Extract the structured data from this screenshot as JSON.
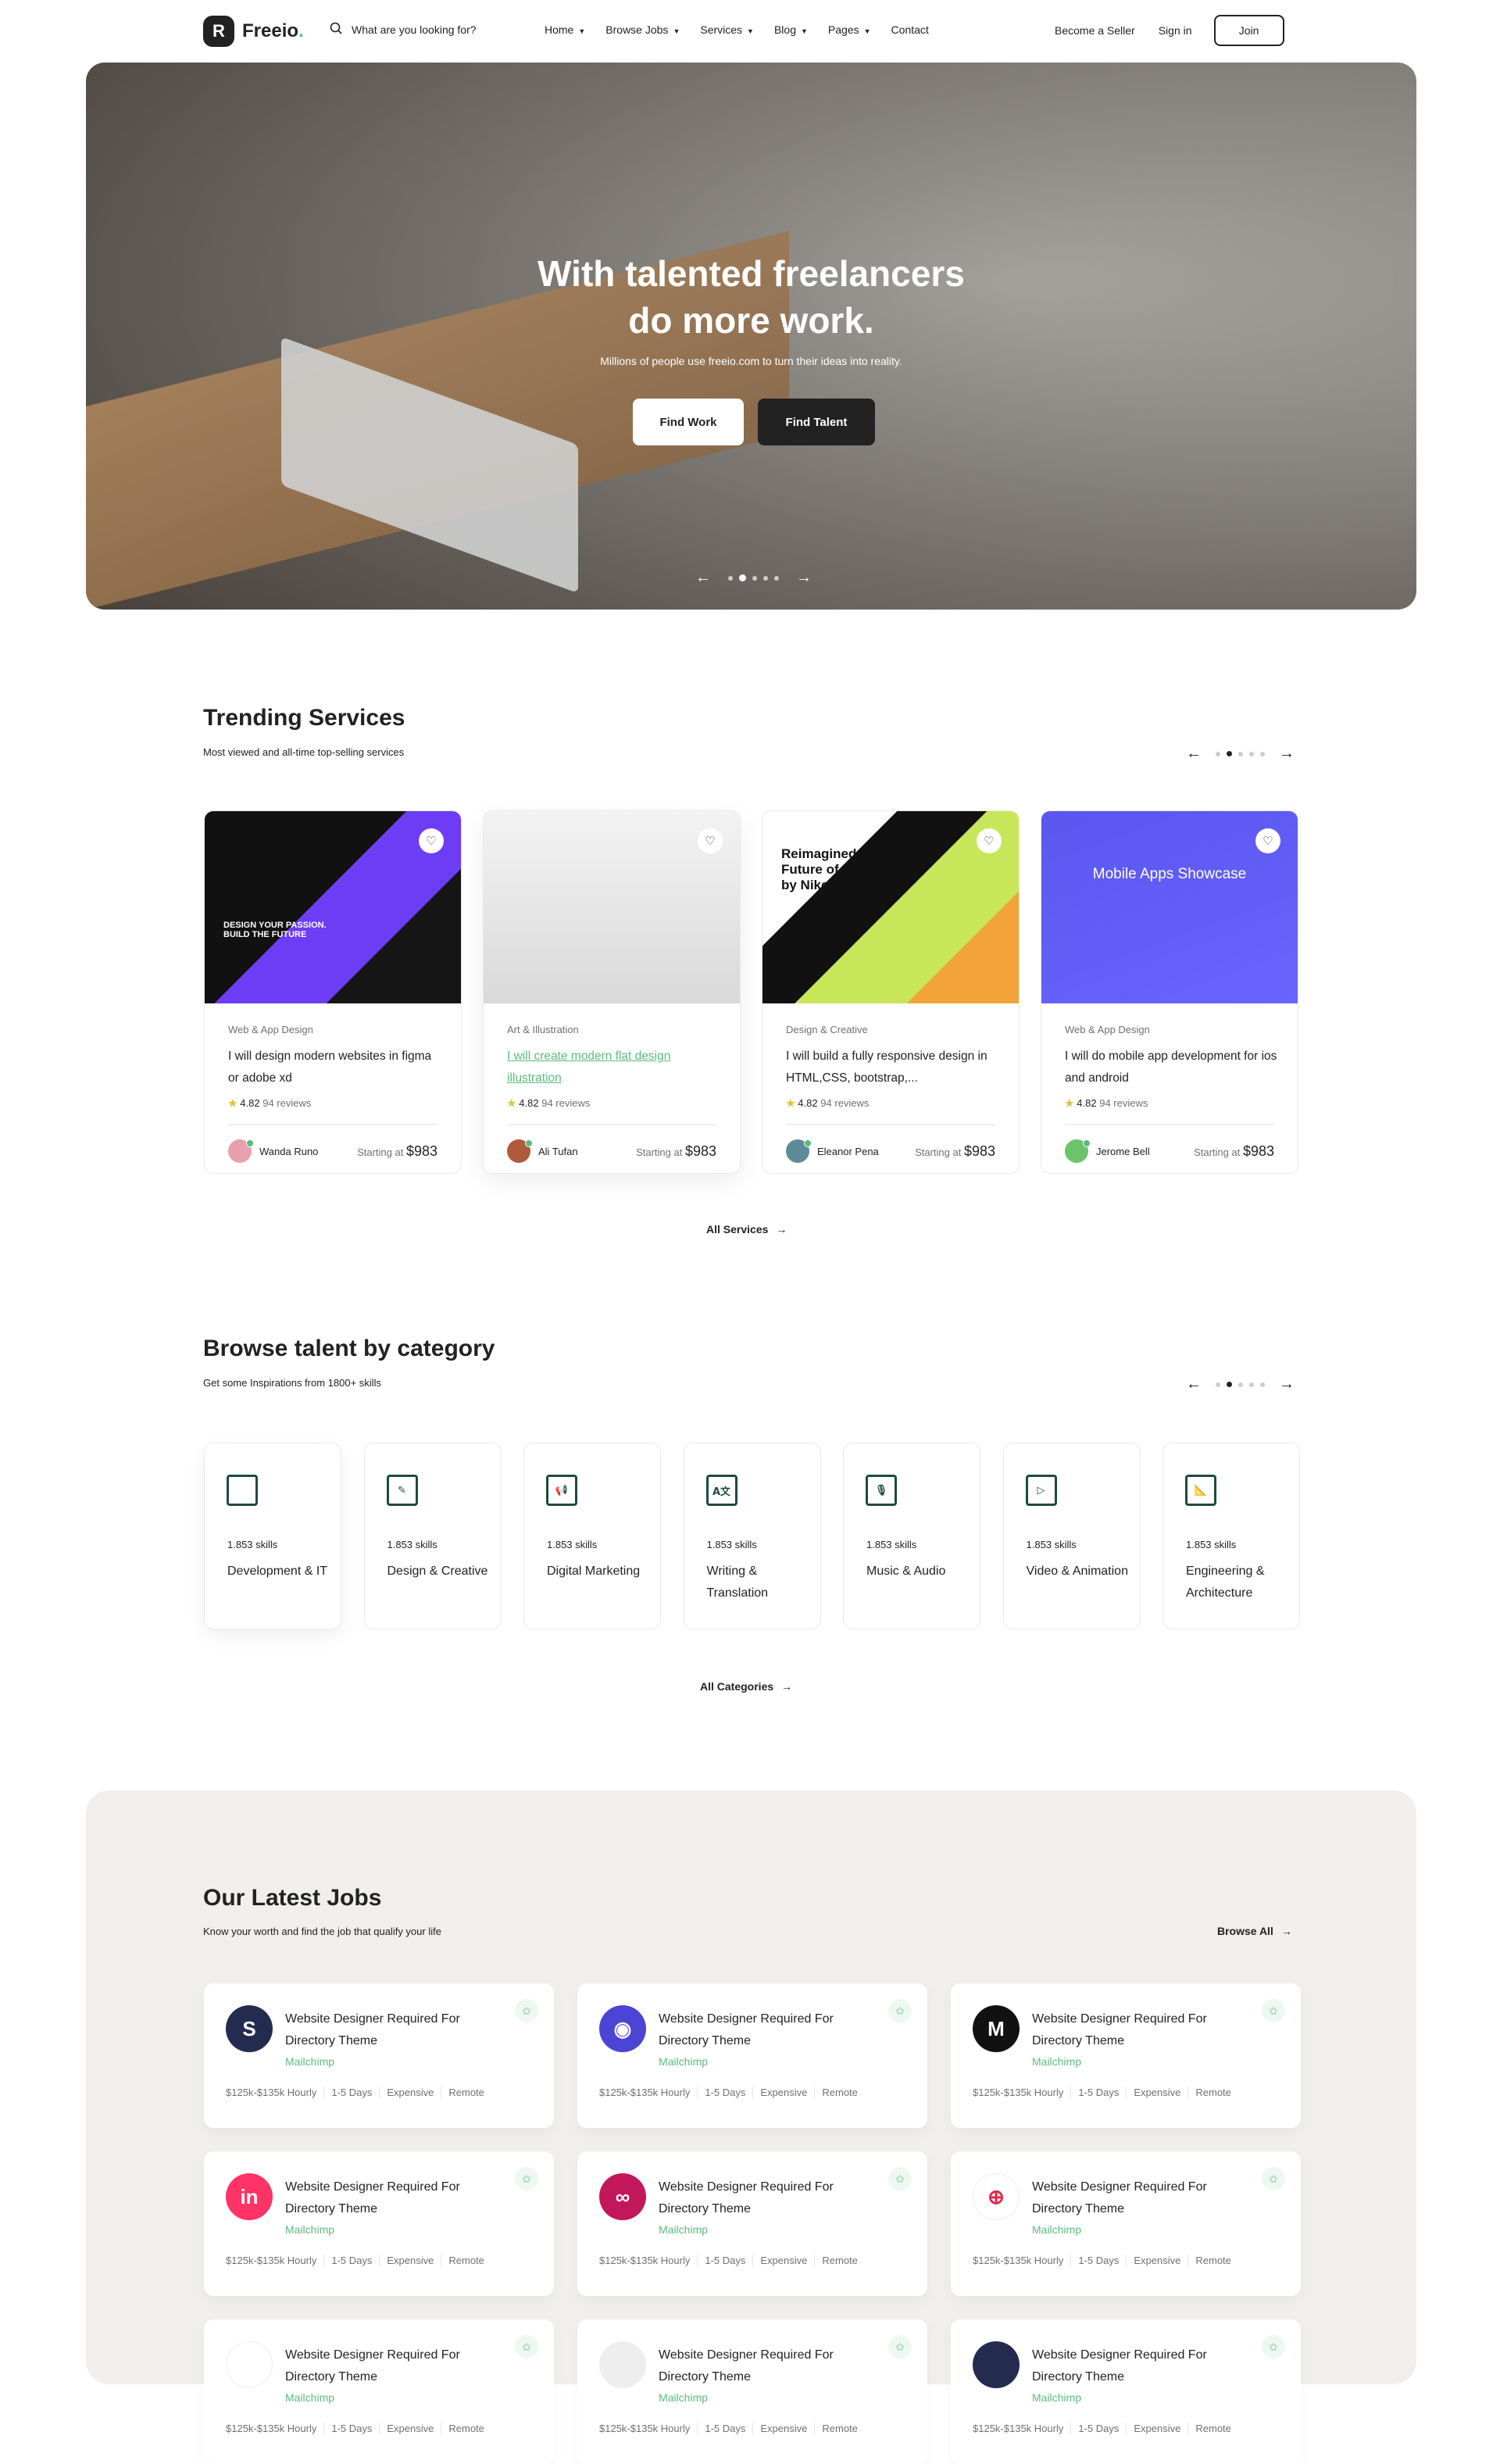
{
  "nav": {
    "logo": "Freeio",
    "logo_mark": "R",
    "search_placeholder": "What are you looking for?",
    "menu": [
      {
        "label": "Home",
        "dropdown": true
      },
      {
        "label": "Browse Jobs",
        "dropdown": true
      },
      {
        "label": "Services",
        "dropdown": true
      },
      {
        "label": "Blog",
        "dropdown": true
      },
      {
        "label": "Pages",
        "dropdown": true
      },
      {
        "label": "Contact",
        "dropdown": false
      }
    ],
    "become_seller": "Become a Seller",
    "sign_in": "Sign in",
    "join": "Join"
  },
  "hero": {
    "title_line1": "With talented freelancers",
    "title_line2": "do more work.",
    "subtitle": "Millions of people use freeio.com to turn their ideas into reality.",
    "find_work": "Find Work",
    "find_talent": "Find Talent",
    "slide_count": 5,
    "active_slide": 2
  },
  "trending": {
    "title": "Trending Services",
    "subtitle": "Most viewed and all-time top-selling services",
    "all_label": "All Services",
    "cards": [
      {
        "category": "Web & App Design",
        "title": "I will design modern websites in figma or adobe xd",
        "rating": "4.82",
        "reviews": "94 reviews",
        "seller": "Wanda Runo",
        "starting": "Starting at",
        "price": "$983",
        "img_text": "DESIGN YOUR PASSION. BUILD THE FUTURE"
      },
      {
        "category": "Art & Illustration",
        "title": "I will create modern flat design illustration",
        "rating": "4.82",
        "reviews": "94 reviews",
        "seller": "Ali Tufan",
        "starting": "Starting at",
        "price": "$983"
      },
      {
        "category": "Design & Creative",
        "title": "I will build a fully responsive design in HTML,CSS, bootstrap,...",
        "rating": "4.82",
        "reviews": "94 reviews",
        "seller": "Eleanor Pena",
        "starting": "Starting at",
        "price": "$983",
        "img_text": "Reimagined Future of Motion by Nike."
      },
      {
        "category": "Web & App Design",
        "title": "I will do mobile app development for ios and android",
        "rating": "4.82",
        "reviews": "94 reviews",
        "seller": "Jerome Bell",
        "starting": "Starting at",
        "price": "$983",
        "img_text": "Mobile Apps Showcase"
      }
    ]
  },
  "categories": {
    "title": "Browse talent by category",
    "subtitle": "Get some Inspirations from 1800+ skills",
    "all_label": "All Categories",
    "items": [
      {
        "skills": "1.853 skills",
        "name": "Development & IT"
      },
      {
        "skills": "1.853 skills",
        "name": "Design & Creative"
      },
      {
        "skills": "1.853 skills",
        "name": "Digital Marketing"
      },
      {
        "skills": "1.853 skills",
        "name": "Writing & Translation"
      },
      {
        "skills": "1.853 skills",
        "name": "Music & Audio"
      },
      {
        "skills": "1.853 skills",
        "name": "Video & Animation"
      },
      {
        "skills": "1.853 skills",
        "name": "Engineering & Architecture"
      }
    ]
  },
  "jobs": {
    "title": "Our Latest Jobs",
    "subtitle": "Know your worth and find the job that qualify your life",
    "browse_all": "Browse All",
    "items": [
      {
        "title": "Website Designer Required For Directory Theme",
        "company": "Mailchimp",
        "pay": "$125k-$135k Hourly",
        "duration": "1-5 Days",
        "level": "Expensive",
        "type": "Remote",
        "logo": "S",
        "color": "#232c4f"
      },
      {
        "title": "Website Designer Required For Directory Theme",
        "company": "Mailchimp",
        "pay": "$125k-$135k Hourly",
        "duration": "1-5 Days",
        "level": "Expensive",
        "type": "Remote",
        "logo": "◉",
        "color": "#4c44d4"
      },
      {
        "title": "Website Designer Required For Directory Theme",
        "company": "Mailchimp",
        "pay": "$125k-$135k Hourly",
        "duration": "1-5 Days",
        "level": "Expensive",
        "type": "Remote",
        "logo": "M",
        "color": "#111111"
      },
      {
        "title": "Website Designer Required For Directory Theme",
        "company": "Mailchimp",
        "pay": "$125k-$135k Hourly",
        "duration": "1-5 Days",
        "level": "Expensive",
        "type": "Remote",
        "logo": "in",
        "color": "#ff3366"
      },
      {
        "title": "Website Designer Required For Directory Theme",
        "company": "Mailchimp",
        "pay": "$125k-$135k Hourly",
        "duration": "1-5 Days",
        "level": "Expensive",
        "type": "Remote",
        "logo": "∞",
        "color": "#c2185b"
      },
      {
        "title": "Website Designer Required For Directory Theme",
        "company": "Mailchimp",
        "pay": "$125k-$135k Hourly",
        "duration": "1-5 Days",
        "level": "Expensive",
        "type": "Remote",
        "logo": "⊕",
        "color": "#ffffff"
      },
      {
        "title": "Website Designer Required For Directory Theme",
        "company": "Mailchimp",
        "pay": "$125k-$135k Hourly",
        "duration": "1-5 Days",
        "level": "Expensive",
        "type": "Remote",
        "logo": "",
        "color": "#ffffff"
      },
      {
        "title": "Website Designer Required For Directory Theme",
        "company": "Mailchimp",
        "pay": "$125k-$135k Hourly",
        "duration": "1-5 Days",
        "level": "Expensive",
        "type": "Remote",
        "logo": "",
        "color": "#eeeeee"
      },
      {
        "title": "Website Designer Required For Directory Theme",
        "company": "Mailchimp",
        "pay": "$125k-$135k Hourly",
        "duration": "1-5 Days",
        "level": "Expensive",
        "type": "Remote",
        "logo": "",
        "color": "#232c4f"
      }
    ]
  },
  "colors": {
    "accent": "#5bbb7b",
    "dark": "#222222",
    "jobs_bg": "#f0efec",
    "star": "#e1c03f"
  }
}
